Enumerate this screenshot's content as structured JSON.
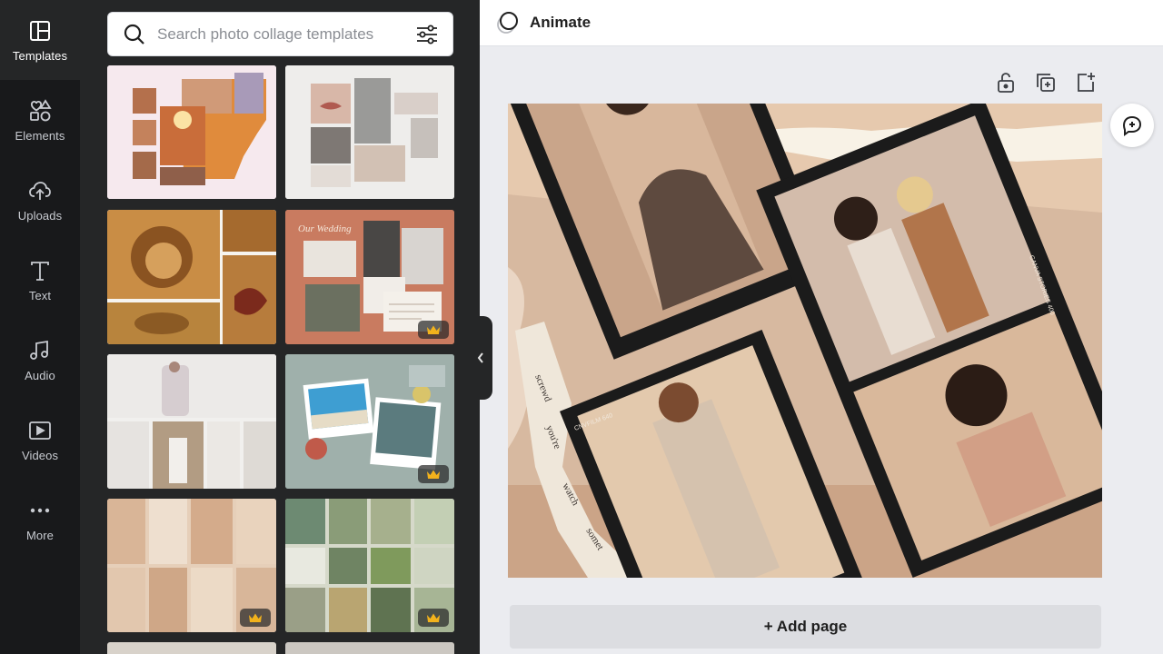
{
  "rail": {
    "items": [
      {
        "label": "Templates",
        "icon": "layout-icon",
        "active": true
      },
      {
        "label": "Elements",
        "icon": "shapes-icon"
      },
      {
        "label": "Uploads",
        "icon": "cloud-upload-icon"
      },
      {
        "label": "Text",
        "icon": "text-icon"
      },
      {
        "label": "Audio",
        "icon": "music-note-icon"
      },
      {
        "label": "Videos",
        "icon": "video-icon"
      },
      {
        "label": "More",
        "icon": "more-dots-icon"
      }
    ]
  },
  "search": {
    "placeholder": "Search photo collage templates"
  },
  "templates": [
    {
      "name": "sunset-beach-collage",
      "premium": false
    },
    {
      "name": "mood-board-collage",
      "premium": false
    },
    {
      "name": "lion-collage",
      "premium": false
    },
    {
      "name": "wedding-collage",
      "premium": true,
      "script_title": "Our Wedding"
    },
    {
      "name": "white-fashion-collage",
      "premium": false
    },
    {
      "name": "travel-scrapbook-collage",
      "premium": true
    },
    {
      "name": "beige-aesthetic-collage",
      "premium": true
    },
    {
      "name": "green-nature-collage",
      "premium": true
    }
  ],
  "topbar": {
    "animate_label": "Animate"
  },
  "toolbar": {
    "lock": "lock-icon",
    "duplicate": "duplicate-page-icon",
    "add": "add-page-icon"
  },
  "canvas": {
    "film_label_1": "CANVA STORIES 400",
    "film_label_2": "CNVFILM 640"
  },
  "footer": {
    "add_page_label": "+ Add page"
  },
  "colors": {
    "rail_bg": "#18191b",
    "panel_bg": "#252627",
    "canvas_bg": "#ebecf0",
    "accent_beige": "#d8b69a"
  }
}
